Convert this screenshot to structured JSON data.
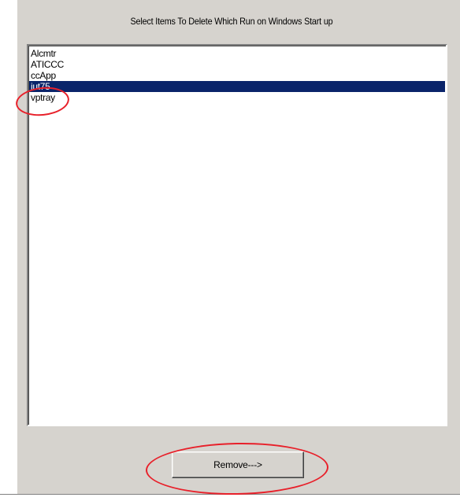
{
  "dialog": {
    "title": "Select Items To Delete Which Run on Windows Start up"
  },
  "listbox": {
    "items": [
      {
        "label": "Alcmtr",
        "selected": false
      },
      {
        "label": "ATICCC",
        "selected": false
      },
      {
        "label": "ccApp",
        "selected": false
      },
      {
        "label": "iut75",
        "selected": true
      },
      {
        "label": "vptray",
        "selected": false
      }
    ]
  },
  "buttons": {
    "remove_label": "Remove--->"
  },
  "annotations": {
    "highlight_color": "#e8202a"
  },
  "colors": {
    "dialog_bg": "#d6d3ce",
    "selection_bg": "#0a246a"
  }
}
